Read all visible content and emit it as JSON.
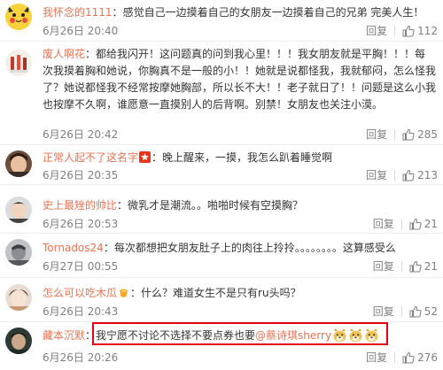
{
  "actions": {
    "reply_label": "回复"
  },
  "comments": [
    {
      "username": "我怀念的1111",
      "separator": "：",
      "text": "感觉自己一边摸着自己的女朋友一边摸着自己的兄弟  完美人生！",
      "time": "6月26日 20:40",
      "likes": "112"
    },
    {
      "username": "废人啊花",
      "separator": "：",
      "text": "都给我闪开！这问题真的问到我心里！！！我女朋友就是平胸！！！每次我摸着胸和她说，你胸真不是一般的小！！她就是说都怪我，我就郁闷，怎么怪我了？她说都怪我不经常按摩她胸部，所以长不大！！老子就日了！！问题是这么小我也按摩不久啊，谁愿意一直摸别人的后背啊。别禁！女朋友也关注小漠。",
      "time": "6月26日 20:42",
      "likes": "285"
    },
    {
      "username": "正常人起不了这名字",
      "separator": "：",
      "text": "晚上醒来，一摸，我怎么趴着睡觉啊",
      "time": "6月26日 20:35",
      "likes": "213"
    },
    {
      "username": "史上最矬的帅比",
      "separator": "：",
      "text": "微乳才是潮流。。啪啪时候有空摸胸？",
      "time": "6月26日 20:53",
      "likes": "21"
    },
    {
      "username": "Tornados24",
      "separator": "：",
      "text": "每次都想把女朋友肚子上的肉往上拎拎。。。。。。。。这算感受么",
      "time": "6月27日 00:55",
      "likes": "21"
    },
    {
      "username": "怎么可以吃木瓜",
      "separator": "：",
      "text": "什么？难道女生不是只有ru头吗？",
      "time": "6月26日 20:43",
      "likes": "52"
    },
    {
      "username": "藏本沉默",
      "separator": "：",
      "text": "我宁愿不讨论不选择不要点券也要",
      "mention": "@蔡诗琪sherry",
      "time": "6月26日 20:26",
      "likes": "276"
    }
  ]
}
